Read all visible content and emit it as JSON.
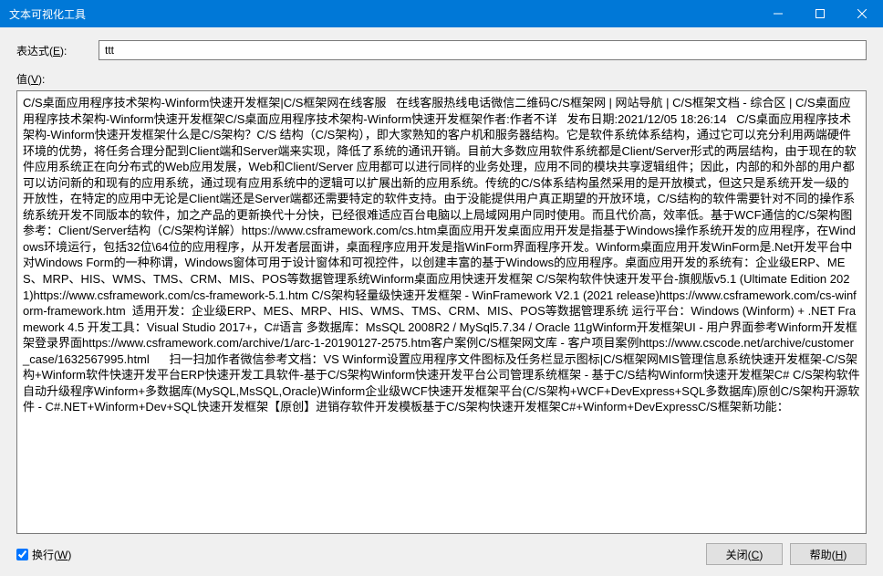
{
  "window": {
    "title": "文本可视化工具"
  },
  "labels": {
    "expression": "表达式(E):",
    "value": "值(V):",
    "wrap": "换行(W)",
    "close": "关闭(C)",
    "help": "帮助(H)"
  },
  "expression": {
    "value": "ttt"
  },
  "wrap_checked": true,
  "value_text": "C/S桌面应用程序技术架构-Winform快速开发框架|C/S框架网在线客服   在线客服热线电话微信二维码C/S框架网 | 网站导航 | C/S框架文档 - 综合区 | C/S桌面应用程序技术架构-Winform快速开发框架C/S桌面应用程序技术架构-Winform快速开发框架作者:作者不详   发布日期:2021/12/05 18:26:14   C/S桌面应用程序技术架构-Winform快速开发框架什么是C/S架构？C/S 结构（C/S架构），即大家熟知的客户机和服务器结构。它是软件系统体系结构，通过它可以充分利用两端硬件环境的优势，将任务合理分配到Client端和Server端来实现，降低了系统的通讯开销。目前大多数应用软件系统都是Client/Server形式的两层结构，由于现在的软件应用系统正在向分布式的Web应用发展，Web和Client/Server 应用都可以进行同样的业务处理，应用不同的模块共享逻辑组件；因此，内部的和外部的用户都可以访问新的和现有的应用系统，通过现有应用系统中的逻辑可以扩展出新的应用系统。传统的C/S体系结构虽然采用的是开放模式，但这只是系统开发一级的开放性，在特定的应用中无论是Client端还是Server端都还需要特定的软件支持。由于没能提供用户真正期望的开放环境，C/S结构的软件需要针对不同的操作系统系统开发不同版本的软件，加之产品的更新换代十分快，已经很难适应百台电脑以上局域网用户同时使用。而且代价高，效率低。基于WCF通信的C/S架构图参考：Client/Server结构（C/S架构详解）https://www.csframework.com/cs.htm桌面应用开发桌面应用开发是指基于Windows操作系统开发的应用程序，在Windows环境运行，包括32位\\64位的应用程序，从开发者层面讲，桌面程序应用开发是指WinForm界面程序开发。Winform桌面应用开发WinForm是.Net开发平台中对Windows Form的一种称谓，Windows窗体可用于设计窗体和可视控件，以创建丰富的基于Windows的应用程序。桌面应用开发的系统有：企业级ERP、MES、MRP、HIS、WMS、TMS、CRM、MIS、POS等数据管理系统Winform桌面应用快速开发框架 C/S架构软件快速开发平台-旗舰版v5.1 (Ultimate Edition 2021)https://www.csframework.com/cs-framework-5.1.htm C/S架构轻量级快速开发框架 - WinFramework V2.1 (2021 release)https://www.csframework.com/cs-winform-framework.htm  适用开发：企业级ERP、MES、MRP、HIS、WMS、TMS、CRM、MIS、POS等数据管理系统 运行平台：Windows (Winform) + .NET Framework 4.5 开发工具：Visual Studio 2017+，C#语言 多数据库：MsSQL 2008R2 / MySql5.7.34 / Oracle 11gWinform开发框架UI - 用户界面参考Winform开发框架登录界面https://www.csframework.com/archive/1/arc-1-20190127-2575.htm客户案例C/S框架网文库 - 客户项目案例https://www.cscode.net/archive/customer_case/1632567995.html      扫一扫加作者微信参考文档：VS Winform设置应用程序文件图标及任务栏显示图标|C/S框架网MIS管理信息系统快速开发框架-C/S架构+Winform软件快速开发平台ERP快速开发工具软件-基于C/S架构Winform快速开发平台公司管理系统框架 - 基于C/S结构Winform快速开发框架C# C/S架构软件自动升级程序Winform+多数据库(MySQL,MsSQL,Oracle)Winform企业级WCF快速开发框架平台(C/S架构+WCF+DevExpress+SQL多数据库)原创C/S架构开源软件 - C#.NET+Winform+Dev+SQL快速开发框架【原创】进销存软件开发模板基于C/S架构快速开发框架C#+Winform+DevExpressC/S框架新功能："
}
